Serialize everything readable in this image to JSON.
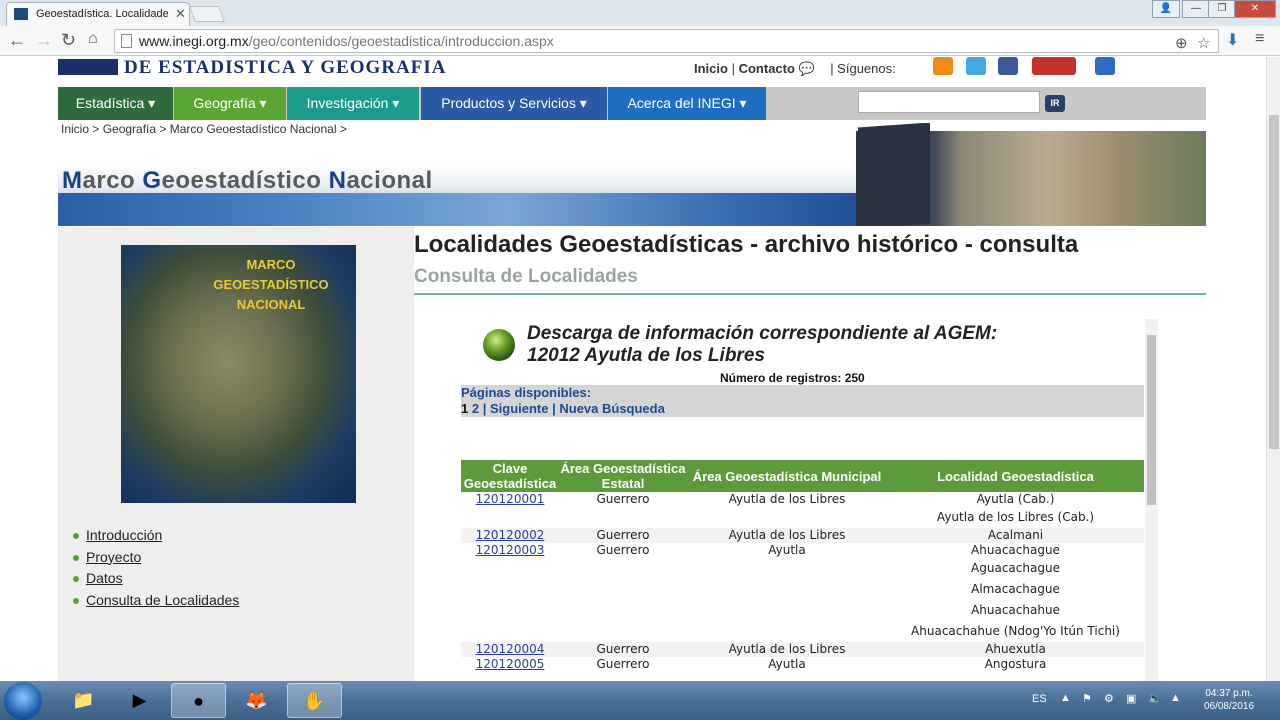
{
  "browser": {
    "tab_title": "Geoestadística. Localidade",
    "url_host": "www.inegi.org.mx",
    "url_path": "/geo/contenidos/geoestadistica/introduccion.aspx"
  },
  "site": {
    "logo_text": "DE ESTADISTICA Y GEOGRAFIA",
    "toplinks": {
      "inicio": "Inicio",
      "sep": "|",
      "contacto": "Contacto",
      "siguenos": "| Síguenos:"
    },
    "menu": [
      {
        "label": "Estadística ▾",
        "color": "#2e6b3c"
      },
      {
        "label": "Geografía ▾",
        "color": "#5ba633"
      },
      {
        "label": "Investigación ▾",
        "color": "#1b9b8c"
      },
      {
        "label": "Productos y Servicios ▾",
        "color": "#2a5aa6"
      },
      {
        "label": "Acerca del INEGI ▾",
        "color": "#1e6fc3"
      }
    ],
    "search_button": "IR",
    "breadcrumb": "Inicio >  Geografía >  Marco Geoestadístico Nacional >",
    "banner_title_parts": [
      "M",
      "arco ",
      "G",
      "eoestadístico ",
      "N",
      "acional"
    ]
  },
  "sidebar": {
    "map_caption": "MARCO GEOESTADÍSTICO NACIONAL",
    "nav": [
      "Introducción",
      "Proyecto",
      "Datos",
      "Consulta de Localidades"
    ]
  },
  "content": {
    "title": "Localidades Geoestadísticas - archivo histórico - consulta",
    "subtitle": "Consulta de Localidades",
    "dl_title_line1": "Descarga de información correspondiente al AGEM:",
    "dl_title_line2": "12012 Ayutla de los Libres",
    "num_registros": "Número de registros: 250",
    "pages_label": "Páginas disponibles:",
    "page_current": "1",
    "page_2": "2",
    "siguiente": "Siguiente",
    "nueva_busqueda": "Nueva Búsqueda",
    "table_headers": [
      "Clave Geoestadística",
      "Área Geoestadística Estatal",
      "Área Geoestadística Municipal",
      "Localidad Geoestadística"
    ],
    "rows": [
      {
        "clave": "120120001",
        "estatal": "Guerrero",
        "municipal": "Ayutla de los Libres",
        "localidades": [
          "Ayutla (Cab.)",
          "Ayutla de los Libres (Cab.)"
        ]
      },
      {
        "clave": "120120002",
        "estatal": "Guerrero",
        "municipal": "Ayutla de los Libres",
        "localidades": [
          "Acalmani"
        ]
      },
      {
        "clave": "120120003",
        "estatal": "Guerrero",
        "municipal": "Ayutla",
        "localidades": [
          "Ahuacachague",
          "Aguacachague",
          "Almacachague",
          "Ahuacachahue",
          "Ahuacachahue (Ndog'Yo Itún Tichi)"
        ]
      },
      {
        "clave": "120120004",
        "estatal": "Guerrero",
        "municipal": "Ayutla de los Libres",
        "localidades": [
          "Ahuexutla"
        ]
      },
      {
        "clave": "120120005",
        "estatal": "Guerrero",
        "municipal": "Ayutla",
        "localidades": [
          "Angostura"
        ]
      }
    ]
  },
  "taskbar": {
    "lang": "ES",
    "time": "04:37 p.m.",
    "date": "06/08/2016"
  }
}
